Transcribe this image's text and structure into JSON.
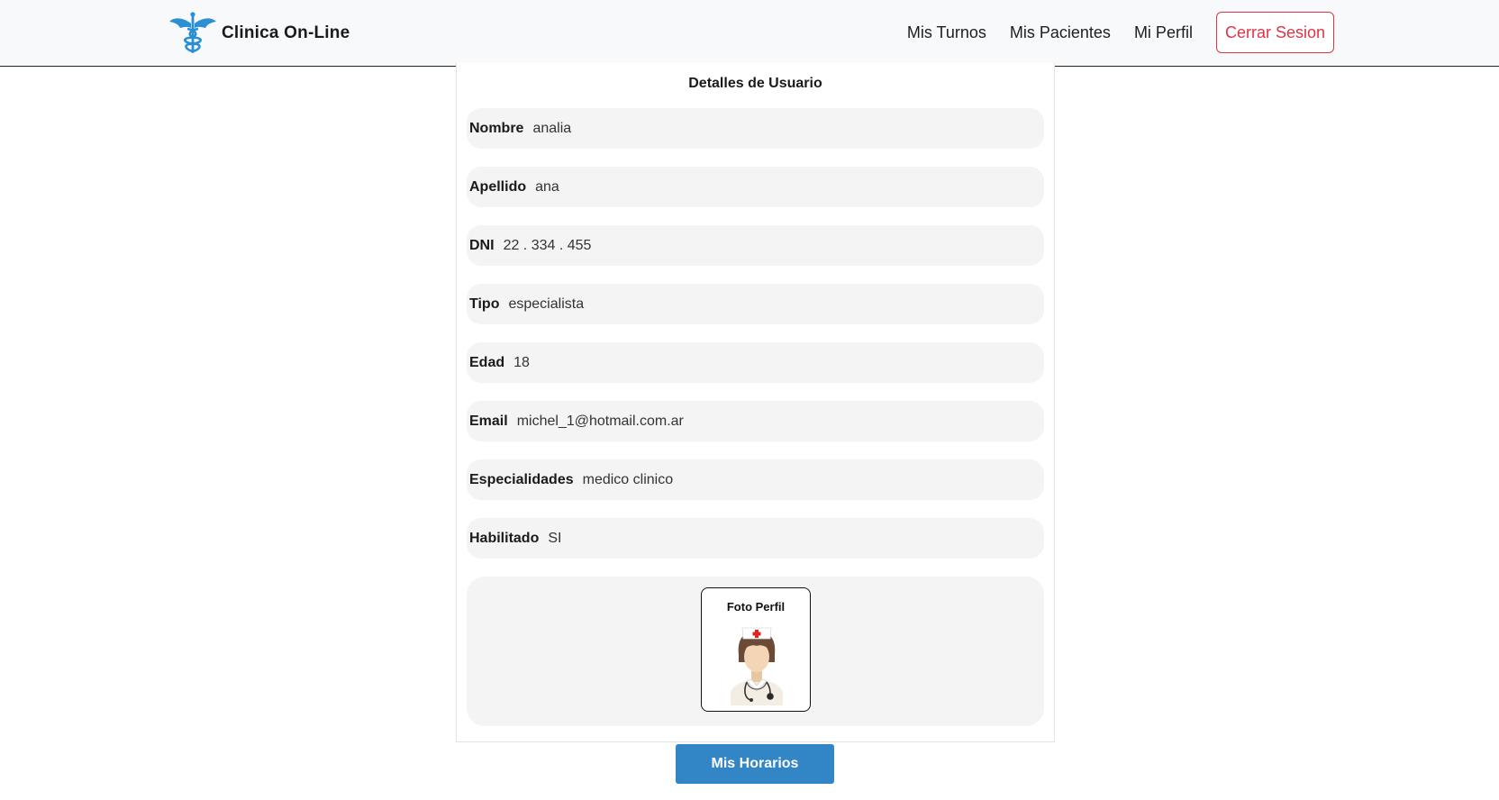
{
  "navbar": {
    "brand": "Clinica On-Line",
    "brand_icon": "caduceus-icon",
    "brand_color": "#2b8fd4",
    "links": [
      "Mis Turnos",
      "Mis Pacientes",
      "Mi Perfil"
    ],
    "logout_label": "Cerrar Sesion",
    "logout_color": "#dc3545"
  },
  "card": {
    "title": "Detalles de Usuario",
    "fields": [
      {
        "label": "Nombre",
        "value": "analia"
      },
      {
        "label": "Apellido",
        "value": "ana"
      },
      {
        "label": "DNI",
        "value": "22 . 334 . 455"
      },
      {
        "label": "Tipo",
        "value": "especialista"
      },
      {
        "label": "Edad",
        "value": "18"
      },
      {
        "label": "Email",
        "value": "michel_1@hotmail.com.ar"
      },
      {
        "label": "Especialidades",
        "value": "medico clinico"
      },
      {
        "label": "Habilitado",
        "value": "SI"
      }
    ],
    "photo_title": "Foto Perfil",
    "photo_icon": "nurse-avatar-icon"
  },
  "actions": {
    "horarios_label": "Mis Horarios",
    "horarios_color": "#3286c6"
  }
}
